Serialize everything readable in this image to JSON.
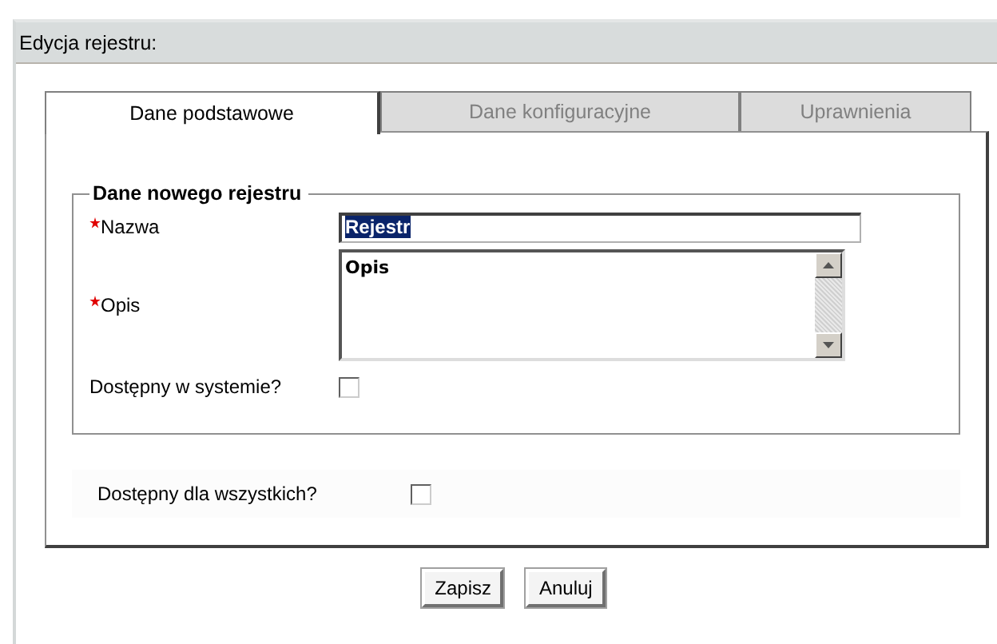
{
  "header": {
    "title": "Edycja rejestru:"
  },
  "tabs": [
    {
      "label": "Dane podstawowe",
      "selected": true
    },
    {
      "label": "Dane konfiguracyjne",
      "selected": false
    },
    {
      "label": "Uprawnienia",
      "selected": false
    }
  ],
  "fieldset": {
    "legend": "Dane nowego rejestru",
    "fields": [
      {
        "kind": "text",
        "label": "Nazwa",
        "required": true,
        "value": "Rejestr",
        "text_selected": true
      },
      {
        "kind": "textarea",
        "label": "Opis",
        "required": true,
        "value": "Opis"
      },
      {
        "kind": "checkbox",
        "label": "Dostępny w systemie?",
        "checked": false
      }
    ]
  },
  "extra_fields": [
    {
      "kind": "checkbox",
      "label": "Dostępny dla wszystkich?",
      "checked": false
    }
  ],
  "buttons": [
    "Zapisz",
    "Anuluj"
  ]
}
